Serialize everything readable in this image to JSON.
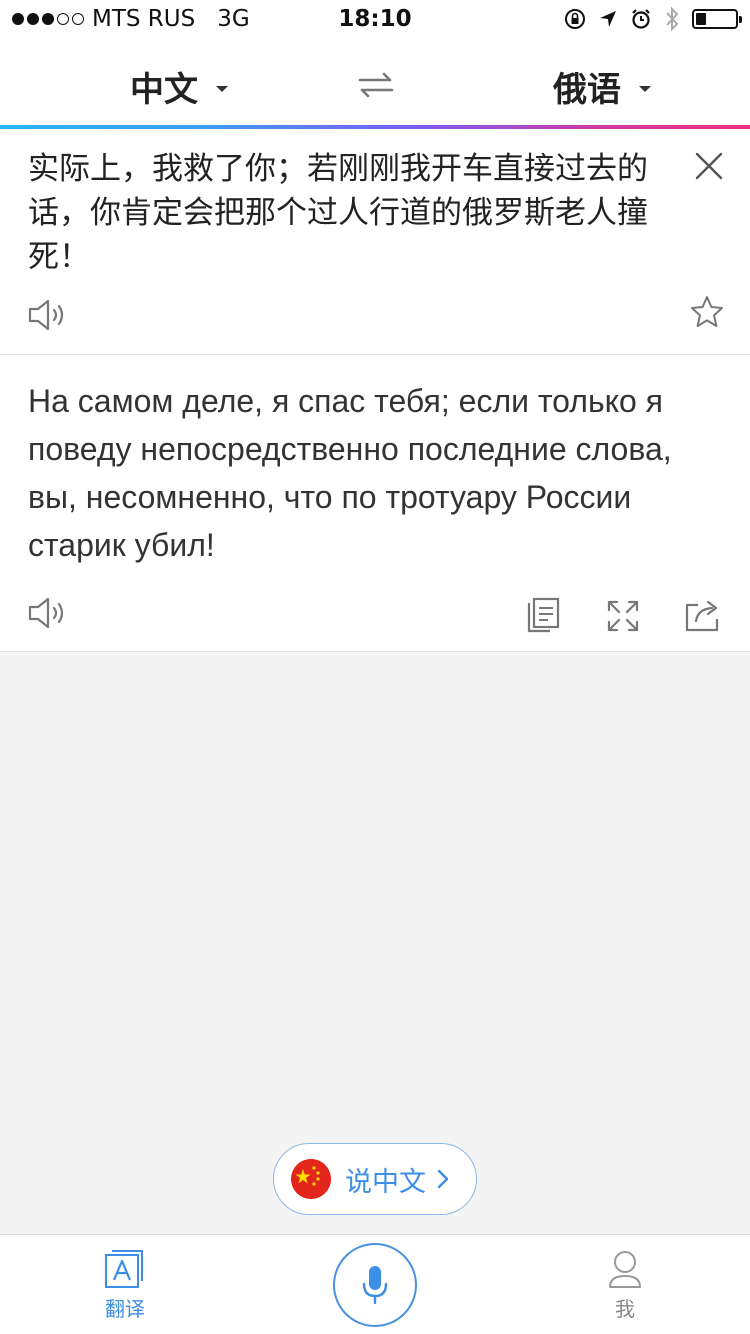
{
  "status_bar": {
    "carrier": "MTS RUS",
    "network": "3G",
    "time": "18:10",
    "signal_bars_filled": 3,
    "signal_bars_total": 5,
    "battery_level": 0.25
  },
  "header": {
    "source_language": "中文",
    "target_language": "俄语"
  },
  "source": {
    "text": " 实际上，我救了你；若刚刚我开车直接过去的话，你肯定会把那个过人行道的俄罗斯老人撞死！"
  },
  "result": {
    "text": "На самом деле, я спас тебя; если только я поведу непосредственно последние слова, вы, несомненно, что по тротуару России старик убил!"
  },
  "speak_button": {
    "label": "说中文"
  },
  "tabs": {
    "translate_label": "翻译",
    "me_label": "我"
  },
  "colors": {
    "accent": "#3d8ee6",
    "flag_red": "#e3261c",
    "flag_yellow": "#ffde00"
  },
  "icons": {
    "swap": "swap-arrows-icon",
    "close": "close-icon",
    "speaker": "speaker-icon",
    "star": "star-icon",
    "copy": "copy-icon",
    "expand": "expand-icon",
    "share": "share-icon",
    "mic": "microphone-icon",
    "flag": "china-flag-icon",
    "translate_tab": "translate-tab-icon",
    "me_tab": "user-icon"
  }
}
